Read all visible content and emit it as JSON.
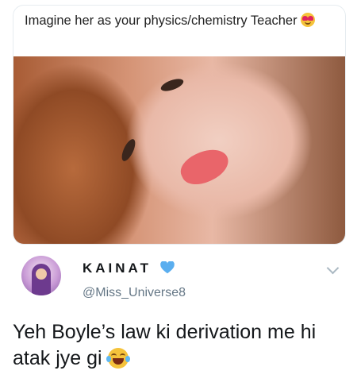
{
  "quoted_tweet": {
    "text": "Imagine her as your physics/chemistry Teacher",
    "emoji": "heart-eyes-emoji"
  },
  "author": {
    "display_name": "KAINAT",
    "handle": "@Miss_Universe8",
    "verified_icon": "blue-heart-icon"
  },
  "tweet": {
    "text": "Yeh Boyle’s law ki derivation me hi atak jye gi",
    "emoji": "tears-of-joy-emoji"
  },
  "colors": {
    "accent_heart": "#5aaeef",
    "handle_gray": "#657786",
    "border": "#e6ecf0"
  }
}
